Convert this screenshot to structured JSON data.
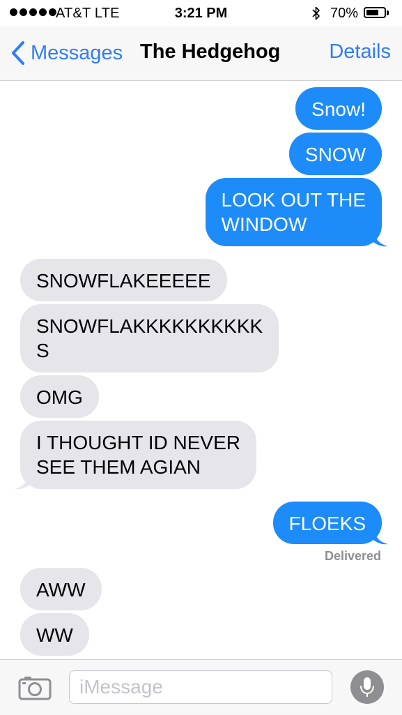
{
  "status_bar": {
    "carrier": "AT&T  LTE",
    "time": "3:21 PM",
    "battery_percent": "70%",
    "battery_level": 0.7,
    "signal_bars": 5
  },
  "nav": {
    "back_label": "Messages",
    "title": "The Hedgehog",
    "details_label": "Details"
  },
  "messages": [
    {
      "from": "me",
      "text": "Snow!"
    },
    {
      "from": "me",
      "text": "SNOW"
    },
    {
      "from": "me",
      "lines": [
        "LOOK OUT THE",
        "WINDOW"
      ]
    },
    {
      "from": "them",
      "text": "SNOWFLAKEEEEE"
    },
    {
      "from": "them",
      "lines": [
        "SNOWFLAKKKKKKKKKK",
        "S"
      ]
    },
    {
      "from": "them",
      "text": "OMG"
    },
    {
      "from": "them",
      "lines": [
        "I THOUGHT ID NEVER",
        "SEE THEM AGIAN"
      ]
    },
    {
      "from": "me",
      "text": "FLOEKS"
    },
    {
      "from": "them",
      "text": "AWW"
    },
    {
      "from": "them",
      "text": "WW"
    }
  ],
  "delivered_label": "Delivered",
  "input": {
    "placeholder": "iMessage",
    "value": ""
  },
  "icons": {
    "back": "chevron-left-icon",
    "camera": "camera-icon",
    "mic": "microphone-icon",
    "bluetooth": "bluetooth-icon",
    "battery": "battery-icon"
  },
  "colors": {
    "accent": "#2f7cf6",
    "outgoing_bubble": "#1d8cf8",
    "incoming_bubble": "#e5e5ea",
    "delivered_text": "#8e8e93"
  }
}
